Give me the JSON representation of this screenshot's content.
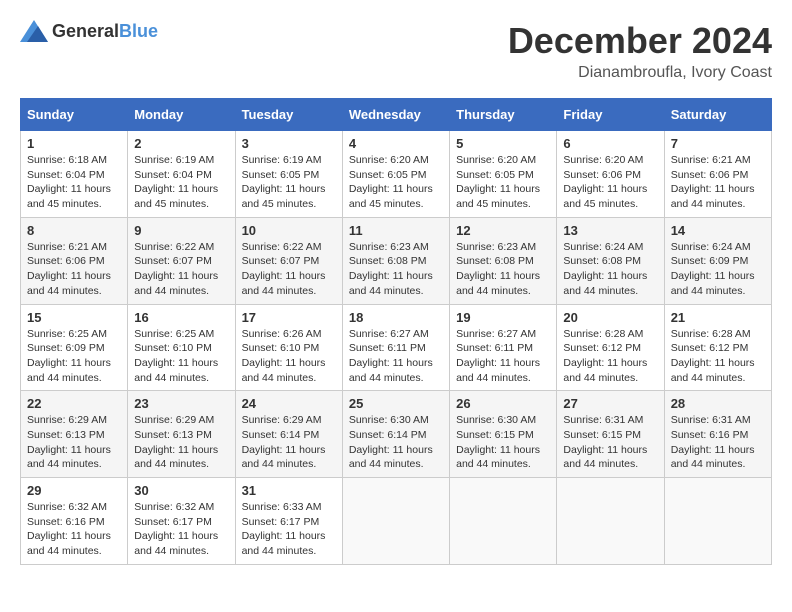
{
  "logo": {
    "general": "General",
    "blue": "Blue"
  },
  "title": "December 2024",
  "location": "Dianambroufla, Ivory Coast",
  "days_of_week": [
    "Sunday",
    "Monday",
    "Tuesday",
    "Wednesday",
    "Thursday",
    "Friday",
    "Saturday"
  ],
  "weeks": [
    [
      {
        "day": "1",
        "sunrise": "6:18 AM",
        "sunset": "6:04 PM",
        "daylight": "11 hours and 45 minutes."
      },
      {
        "day": "2",
        "sunrise": "6:19 AM",
        "sunset": "6:04 PM",
        "daylight": "11 hours and 45 minutes."
      },
      {
        "day": "3",
        "sunrise": "6:19 AM",
        "sunset": "6:05 PM",
        "daylight": "11 hours and 45 minutes."
      },
      {
        "day": "4",
        "sunrise": "6:20 AM",
        "sunset": "6:05 PM",
        "daylight": "11 hours and 45 minutes."
      },
      {
        "day": "5",
        "sunrise": "6:20 AM",
        "sunset": "6:05 PM",
        "daylight": "11 hours and 45 minutes."
      },
      {
        "day": "6",
        "sunrise": "6:20 AM",
        "sunset": "6:06 PM",
        "daylight": "11 hours and 45 minutes."
      },
      {
        "day": "7",
        "sunrise": "6:21 AM",
        "sunset": "6:06 PM",
        "daylight": "11 hours and 44 minutes."
      }
    ],
    [
      {
        "day": "8",
        "sunrise": "6:21 AM",
        "sunset": "6:06 PM",
        "daylight": "11 hours and 44 minutes."
      },
      {
        "day": "9",
        "sunrise": "6:22 AM",
        "sunset": "6:07 PM",
        "daylight": "11 hours and 44 minutes."
      },
      {
        "day": "10",
        "sunrise": "6:22 AM",
        "sunset": "6:07 PM",
        "daylight": "11 hours and 44 minutes."
      },
      {
        "day": "11",
        "sunrise": "6:23 AM",
        "sunset": "6:08 PM",
        "daylight": "11 hours and 44 minutes."
      },
      {
        "day": "12",
        "sunrise": "6:23 AM",
        "sunset": "6:08 PM",
        "daylight": "11 hours and 44 minutes."
      },
      {
        "day": "13",
        "sunrise": "6:24 AM",
        "sunset": "6:08 PM",
        "daylight": "11 hours and 44 minutes."
      },
      {
        "day": "14",
        "sunrise": "6:24 AM",
        "sunset": "6:09 PM",
        "daylight": "11 hours and 44 minutes."
      }
    ],
    [
      {
        "day": "15",
        "sunrise": "6:25 AM",
        "sunset": "6:09 PM",
        "daylight": "11 hours and 44 minutes."
      },
      {
        "day": "16",
        "sunrise": "6:25 AM",
        "sunset": "6:10 PM",
        "daylight": "11 hours and 44 minutes."
      },
      {
        "day": "17",
        "sunrise": "6:26 AM",
        "sunset": "6:10 PM",
        "daylight": "11 hours and 44 minutes."
      },
      {
        "day": "18",
        "sunrise": "6:27 AM",
        "sunset": "6:11 PM",
        "daylight": "11 hours and 44 minutes."
      },
      {
        "day": "19",
        "sunrise": "6:27 AM",
        "sunset": "6:11 PM",
        "daylight": "11 hours and 44 minutes."
      },
      {
        "day": "20",
        "sunrise": "6:28 AM",
        "sunset": "6:12 PM",
        "daylight": "11 hours and 44 minutes."
      },
      {
        "day": "21",
        "sunrise": "6:28 AM",
        "sunset": "6:12 PM",
        "daylight": "11 hours and 44 minutes."
      }
    ],
    [
      {
        "day": "22",
        "sunrise": "6:29 AM",
        "sunset": "6:13 PM",
        "daylight": "11 hours and 44 minutes."
      },
      {
        "day": "23",
        "sunrise": "6:29 AM",
        "sunset": "6:13 PM",
        "daylight": "11 hours and 44 minutes."
      },
      {
        "day": "24",
        "sunrise": "6:29 AM",
        "sunset": "6:14 PM",
        "daylight": "11 hours and 44 minutes."
      },
      {
        "day": "25",
        "sunrise": "6:30 AM",
        "sunset": "6:14 PM",
        "daylight": "11 hours and 44 minutes."
      },
      {
        "day": "26",
        "sunrise": "6:30 AM",
        "sunset": "6:15 PM",
        "daylight": "11 hours and 44 minutes."
      },
      {
        "day": "27",
        "sunrise": "6:31 AM",
        "sunset": "6:15 PM",
        "daylight": "11 hours and 44 minutes."
      },
      {
        "day": "28",
        "sunrise": "6:31 AM",
        "sunset": "6:16 PM",
        "daylight": "11 hours and 44 minutes."
      }
    ],
    [
      {
        "day": "29",
        "sunrise": "6:32 AM",
        "sunset": "6:16 PM",
        "daylight": "11 hours and 44 minutes."
      },
      {
        "day": "30",
        "sunrise": "6:32 AM",
        "sunset": "6:17 PM",
        "daylight": "11 hours and 44 minutes."
      },
      {
        "day": "31",
        "sunrise": "6:33 AM",
        "sunset": "6:17 PM",
        "daylight": "11 hours and 44 minutes."
      },
      null,
      null,
      null,
      null
    ]
  ]
}
